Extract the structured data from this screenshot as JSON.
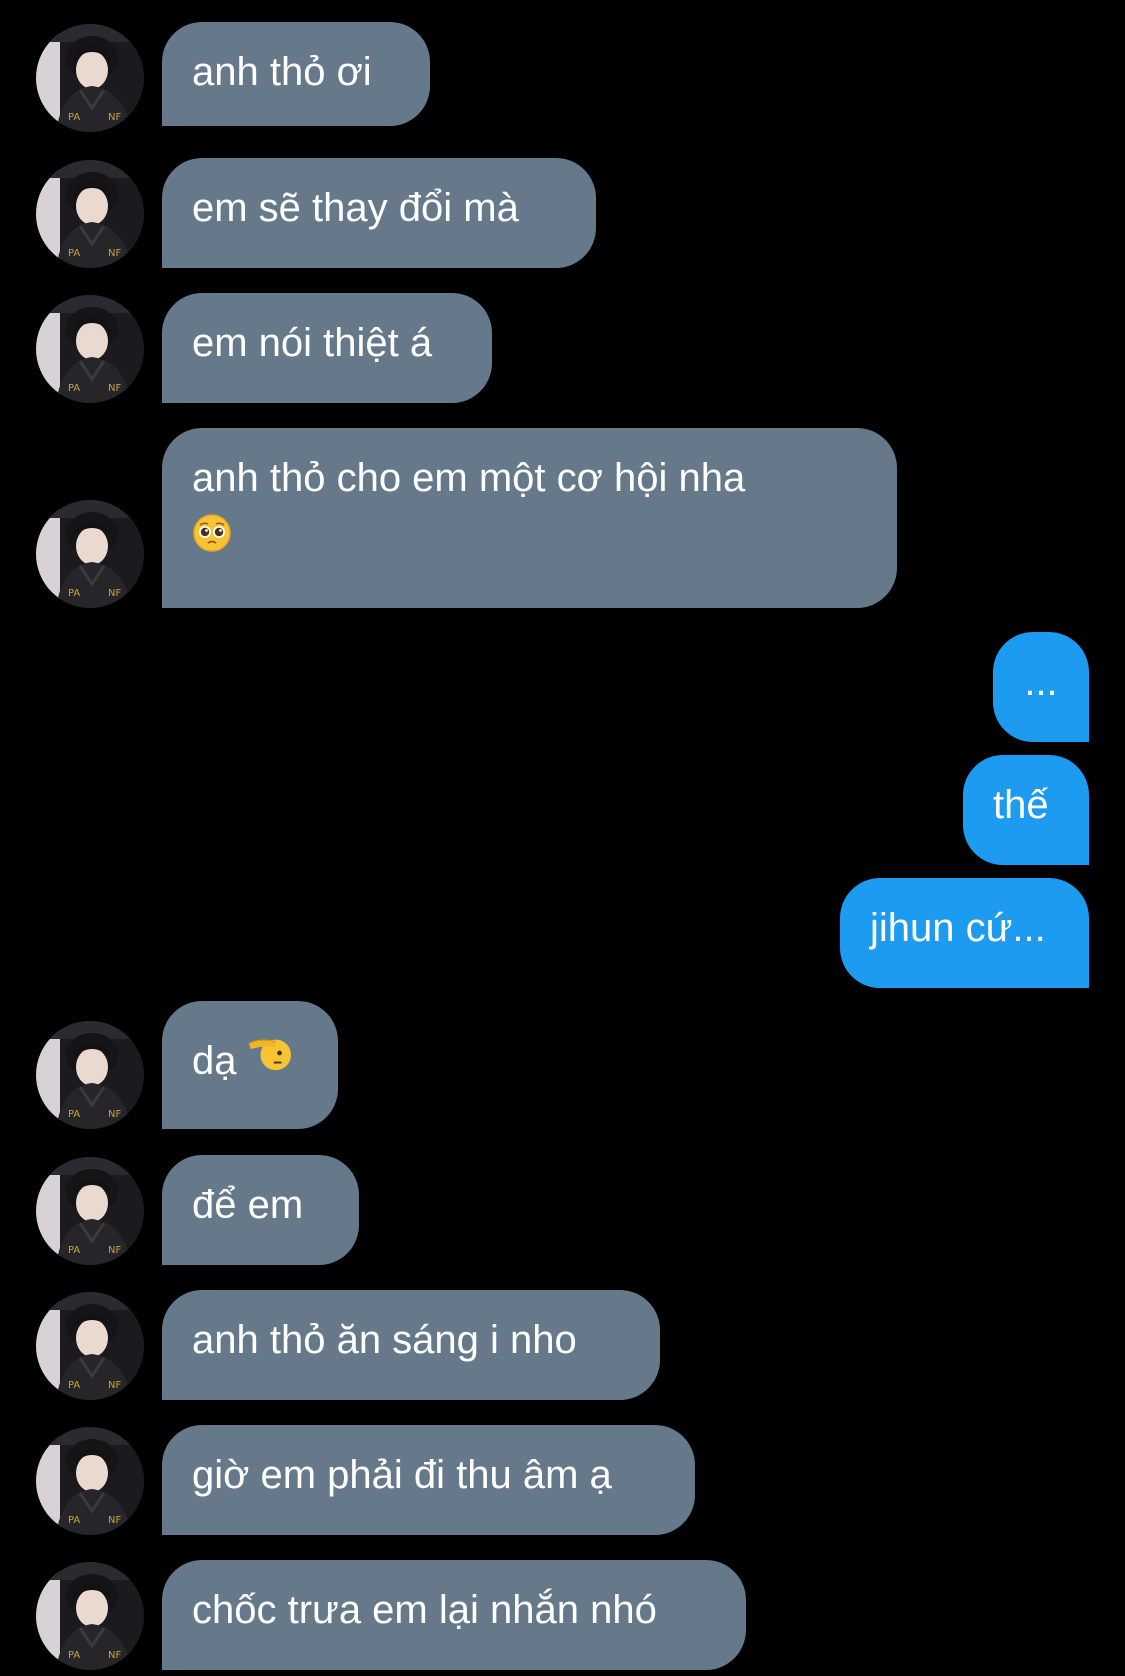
{
  "conversation": {
    "messages": [
      {
        "direction": "incoming",
        "text": "anh thỏ ơi"
      },
      {
        "direction": "incoming",
        "text": "em sẽ thay đổi mà"
      },
      {
        "direction": "incoming",
        "text": "em nói thiệt á"
      },
      {
        "direction": "incoming",
        "text": "anh thỏ cho em một cơ hội nha",
        "emoji": "pleading-face-icon"
      },
      {
        "direction": "outgoing",
        "text": "..."
      },
      {
        "direction": "outgoing",
        "text": "thế"
      },
      {
        "direction": "outgoing",
        "text": "jihun cứ..."
      },
      {
        "direction": "incoming",
        "text": "dạ",
        "emoji": "saluting-face-icon"
      },
      {
        "direction": "incoming",
        "text": "để em"
      },
      {
        "direction": "incoming",
        "text": "anh thỏ ăn sáng i nho"
      },
      {
        "direction": "incoming",
        "text": "giờ em phải đi thu âm ạ"
      },
      {
        "direction": "incoming",
        "text": "chốc trưa em lại nhắn nhó"
      }
    ]
  },
  "colors": {
    "background": "#000000",
    "incoming_bubble": "#66798b",
    "outgoing_bubble": "#1d9bf0",
    "text": "#ffffff"
  }
}
